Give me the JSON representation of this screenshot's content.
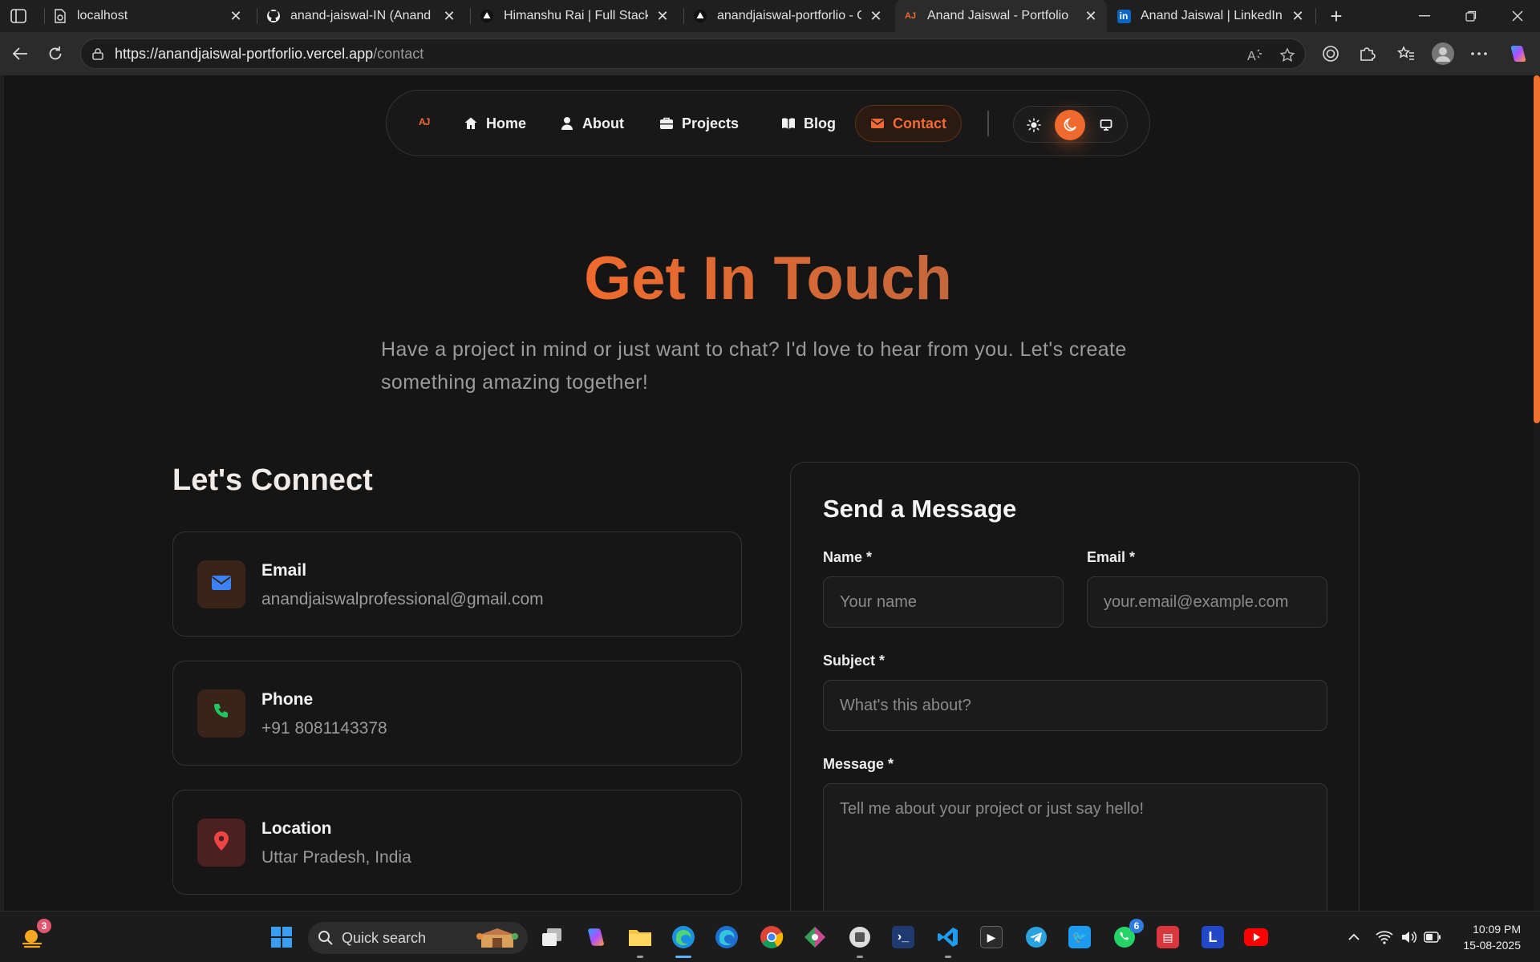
{
  "browser": {
    "tabs": [
      {
        "label": "localhost",
        "icon": "gear-doc-icon"
      },
      {
        "label": "anand-jaiswal-IN (Anand Jaiswal)",
        "icon": "github-icon"
      },
      {
        "label": "Himanshu Rai | Full Stack • Dev",
        "icon": "triangle-icon"
      },
      {
        "label": "anandjaiswal-portforlio - Overview",
        "icon": "vercel-icon"
      },
      {
        "label": "Anand Jaiswal - Portfolio",
        "icon": "aj-logo-icon",
        "active": true
      },
      {
        "label": "Anand Jaiswal | LinkedIn",
        "icon": "linkedin-icon"
      }
    ],
    "url_host": "https://anandjaiswal-portforlio.vercel.app",
    "url_path": "/contact"
  },
  "nav": {
    "logo": "AJ",
    "items": [
      {
        "label": "Home",
        "icon": "home-icon"
      },
      {
        "label": "About",
        "icon": "user-icon"
      },
      {
        "label": "Projects",
        "icon": "briefcase-icon"
      },
      {
        "label": "Blog",
        "icon": "book-icon"
      },
      {
        "label": "Contact",
        "icon": "mail-icon",
        "active": true
      }
    ],
    "theme": {
      "options": [
        "light",
        "dark",
        "system"
      ],
      "selected": "dark"
    }
  },
  "hero": {
    "title": "Get In Touch",
    "subtitle": "Have a project in mind or just want to chat? I'd love to hear from you. Let's create something amazing together!"
  },
  "connect": {
    "title": "Let's Connect",
    "cards": [
      {
        "title": "Email",
        "value": "anandjaiswalprofessional@gmail.com",
        "icon": "mail-icon"
      },
      {
        "title": "Phone",
        "value": "+91 8081143378",
        "icon": "phone-icon"
      },
      {
        "title": "Location",
        "value": "Uttar Pradesh, India",
        "icon": "location-pin-icon"
      }
    ]
  },
  "form": {
    "title": "Send a Message",
    "name_label": "Name *",
    "name_placeholder": "Your name",
    "email_label": "Email *",
    "email_placeholder": "your.email@example.com",
    "subject_label": "Subject *",
    "subject_placeholder": "What's this about?",
    "message_label": "Message *",
    "message_placeholder": "Tell me about your project or just say hello!"
  },
  "taskbar": {
    "search_text": "Quick search",
    "weather_badge": "3",
    "whatsapp_badge": "6",
    "time": "10:09 PM",
    "date": "15-08-2025"
  },
  "colors": {
    "accent": "#f06a2d",
    "background": "#151515",
    "card_border": "#333333",
    "muted_text": "#9a9a9a"
  }
}
